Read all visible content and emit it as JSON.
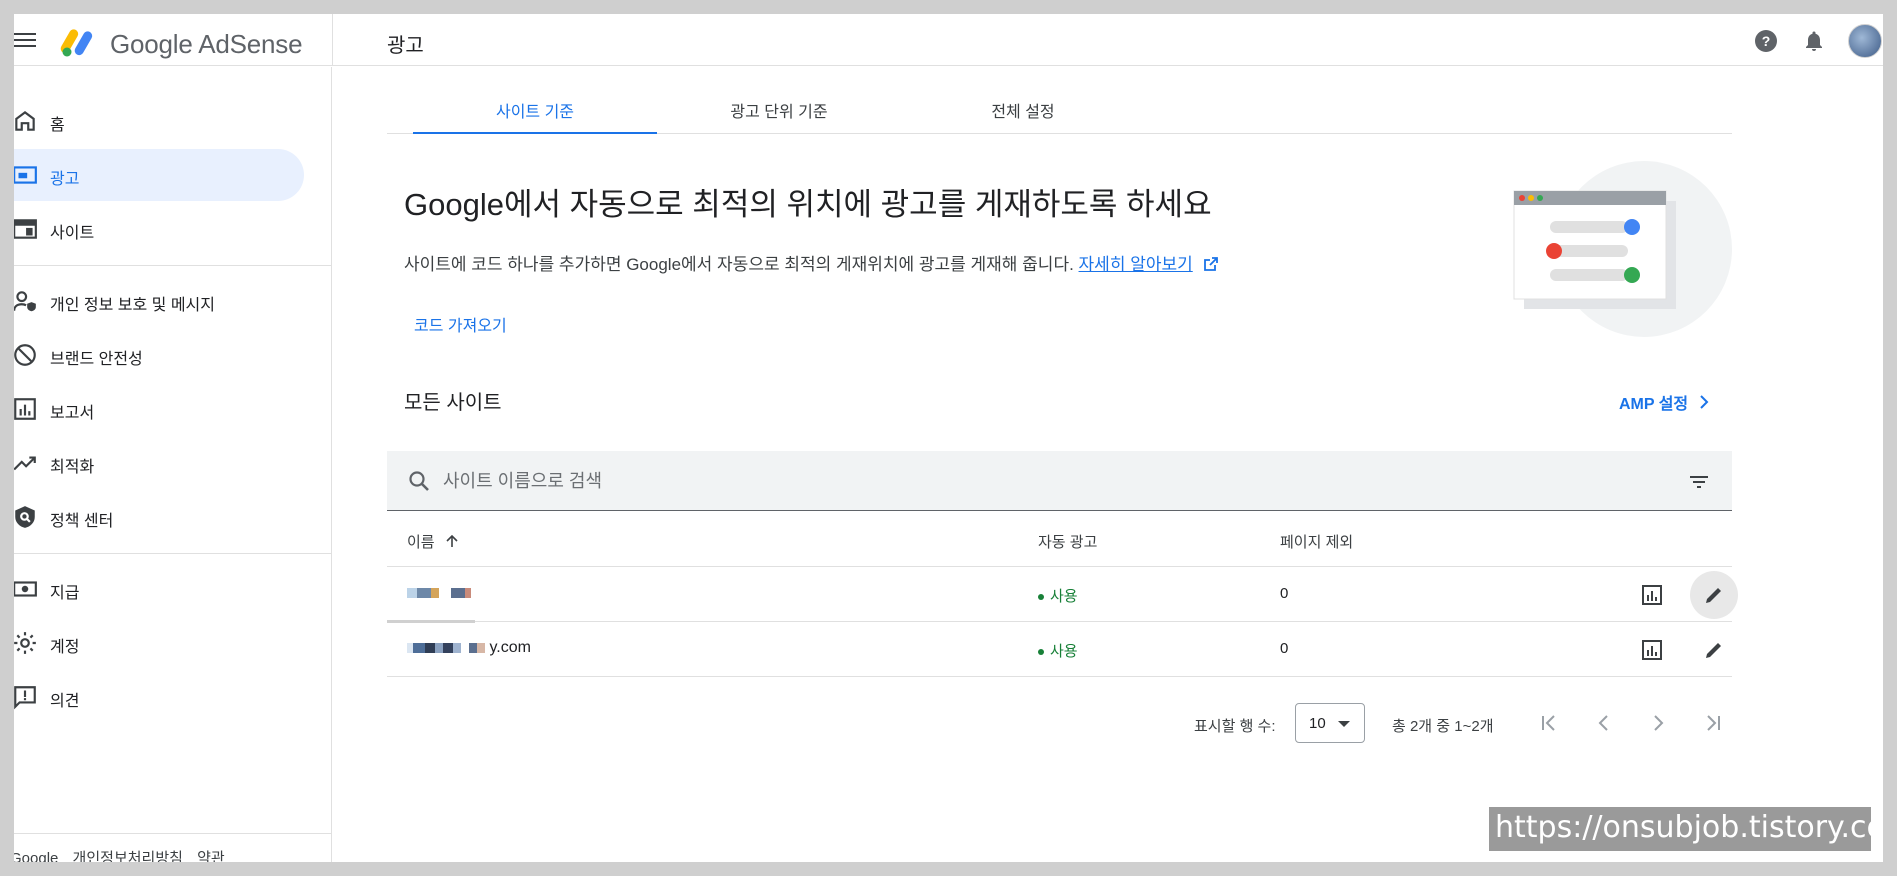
{
  "app": {
    "brand": "Google AdSense",
    "page_title": "광고",
    "colors": {
      "accent": "#1a73e8",
      "active_bg": "#e8f0fe",
      "success": "#188038"
    }
  },
  "header": {
    "icons": [
      "menu-icon",
      "adsense-logo",
      "help-icon",
      "notifications-icon",
      "avatar"
    ]
  },
  "sidebar": {
    "items": [
      {
        "label": "홈",
        "icon": "home-icon"
      },
      {
        "label": "광고",
        "icon": "ads-icon",
        "active": true
      },
      {
        "label": "사이트",
        "icon": "sites-icon"
      },
      {
        "label": "개인 정보 보호 및 메시지",
        "icon": "privacy-icon"
      },
      {
        "label": "브랜드 안전성",
        "icon": "block-icon"
      },
      {
        "label": "보고서",
        "icon": "reports-icon"
      },
      {
        "label": "최적화",
        "icon": "trending-icon"
      },
      {
        "label": "정책 센터",
        "icon": "policy-icon"
      },
      {
        "label": "지급",
        "icon": "payments-icon"
      },
      {
        "label": "계정",
        "icon": "gear-icon"
      },
      {
        "label": "의견",
        "icon": "feedback-icon"
      }
    ],
    "footer": {
      "brand": "Google",
      "privacy": "개인정보처리방침",
      "terms": "약관"
    }
  },
  "tabs": [
    {
      "label": "사이트 기준",
      "active": true
    },
    {
      "label": "광고 단위 기준"
    },
    {
      "label": "전체 설정"
    }
  ],
  "banner": {
    "headline": "Google에서 자동으로 최적의 위치에 광고를 게재하도록 하세요",
    "description": "사이트에 코드 하나를 추가하면 Google에서 자동으로 최적의 게재위치에 광고를 게재해 줍니다.",
    "learn_more": "자세히 알아보기",
    "get_code": "코드 가져오기"
  },
  "sites": {
    "title": "모든 사이트",
    "amp_link": "AMP 설정",
    "search_placeholder": "사이트 이름으로 검색",
    "columns": {
      "name": "이름",
      "sort_icon": "arrow-up-icon",
      "auto_ads": "자동 광고",
      "excluded": "페이지 제외"
    },
    "rows": [
      {
        "name": "",
        "auto_ads": "사용",
        "excluded": "0"
      },
      {
        "name": "y.com",
        "auto_ads": "사용",
        "excluded": "0"
      }
    ]
  },
  "pagination": {
    "rows_label": "표시할 행 수:",
    "rows_value": "10",
    "range": "총 2개 중 1~2개"
  },
  "watermark": "https://onsubjob.tistory.com"
}
